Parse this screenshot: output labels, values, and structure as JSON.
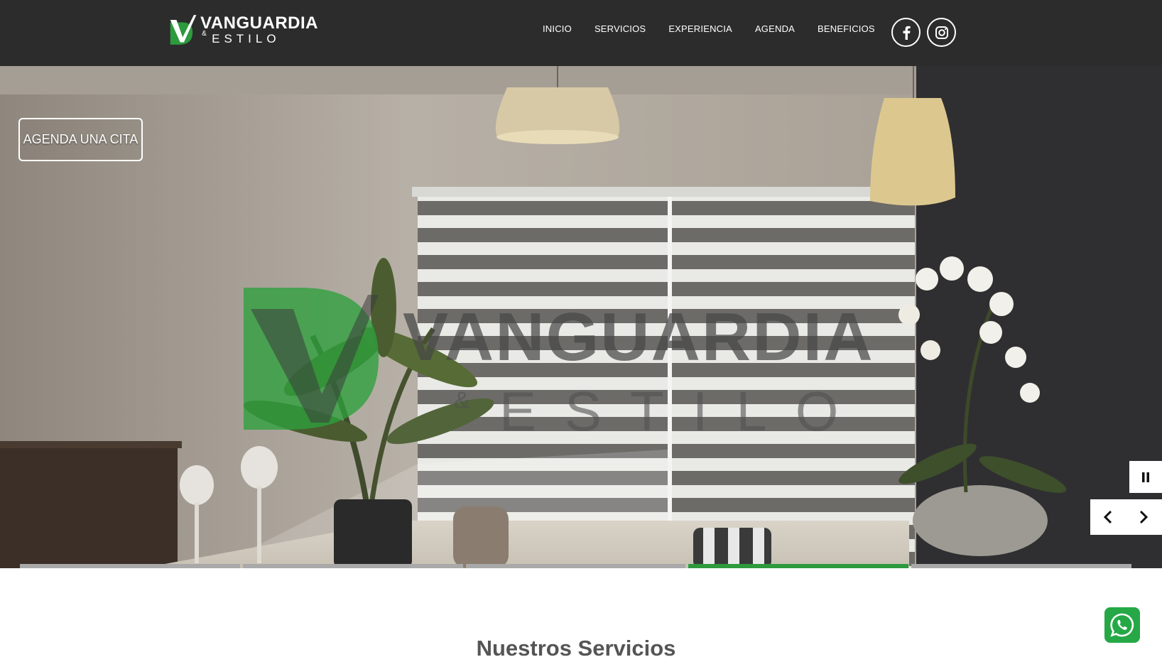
{
  "brand": {
    "title": "VANGUARDIA",
    "amp": "&",
    "subtitle": "ESTILO"
  },
  "nav": {
    "items": [
      "INICIO",
      "SERVICIOS",
      "EXPERIENCIA",
      "AGENDA",
      "BENEFICIOS"
    ]
  },
  "social": {
    "facebook_icon": "facebook-icon",
    "instagram_icon": "instagram-icon"
  },
  "hero": {
    "cta_label": "AGENDA UNA CITA",
    "watermark_title": "VANGUARDIA",
    "watermark_amp": "&",
    "watermark_subtitle": "ESTILO",
    "slideshow": {
      "slide_count": 5,
      "active_slide": 4
    }
  },
  "main": {
    "section_title": "Nuestros Servicios"
  },
  "colors": {
    "header_bg": "#2c2c2c",
    "brand_green": "#2d9a3e",
    "whatsapp_green": "#25a845"
  }
}
